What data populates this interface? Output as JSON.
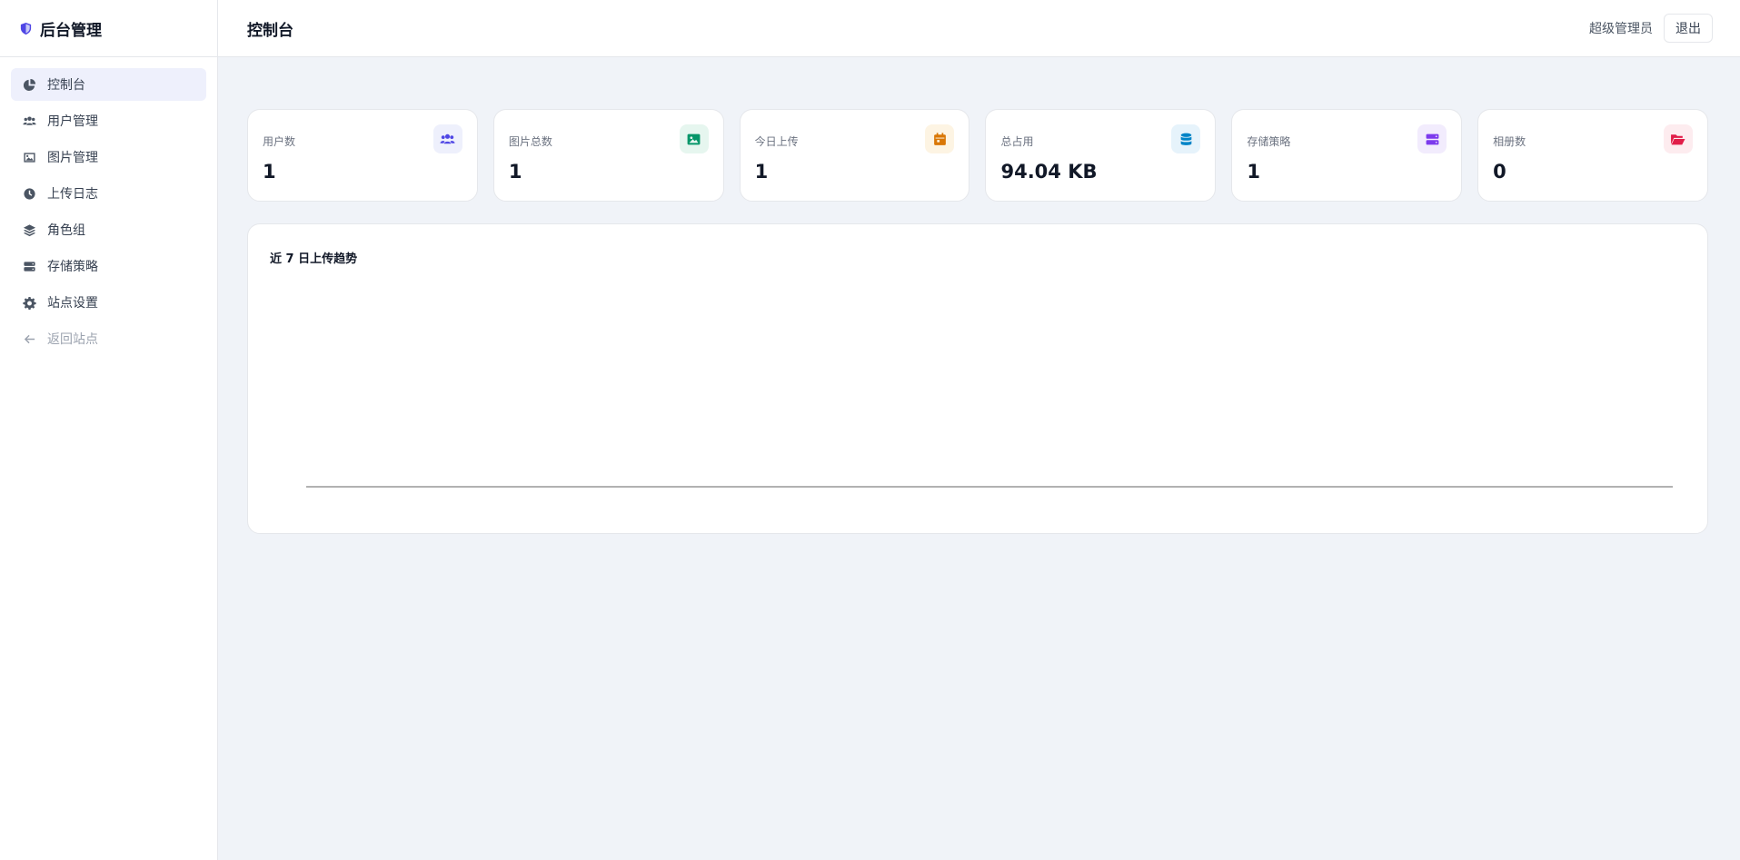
{
  "brand": {
    "title": "后台管理",
    "icon": "shield-icon",
    "icon_color": "#4f46e5"
  },
  "sidebar": {
    "items": [
      {
        "label": "控制台",
        "icon": "pie-chart-icon",
        "active": true
      },
      {
        "label": "用户管理",
        "icon": "users-icon"
      },
      {
        "label": "图片管理",
        "icon": "image-icon"
      },
      {
        "label": "上传日志",
        "icon": "clock-icon"
      },
      {
        "label": "角色组",
        "icon": "layers-icon"
      },
      {
        "label": "存储策略",
        "icon": "server-icon"
      },
      {
        "label": "站点设置",
        "icon": "gear-icon"
      },
      {
        "label": "返回站点",
        "icon": "arrow-left-icon",
        "muted": true
      }
    ]
  },
  "header": {
    "title": "控制台",
    "user": "超级管理员",
    "logout_label": "退出"
  },
  "stats": [
    {
      "label": "用户数",
      "value": "1",
      "icon": "users-icon",
      "color": "#4f46e5",
      "bg": "#eef0fc"
    },
    {
      "label": "图片总数",
      "value": "1",
      "icon": "image-icon",
      "color": "#059669",
      "bg": "#e6f6ef"
    },
    {
      "label": "今日上传",
      "value": "1",
      "icon": "calendar-icon",
      "color": "#d97706",
      "bg": "#fdf4e3"
    },
    {
      "label": "总占用",
      "value": "94.04 KB",
      "icon": "database-icon",
      "color": "#0284c7",
      "bg": "#e6f3fb"
    },
    {
      "label": "存储策略",
      "value": "1",
      "icon": "server-icon",
      "color": "#7c3aed",
      "bg": "#f2ecfd"
    },
    {
      "label": "相册数",
      "value": "0",
      "icon": "folder-open-icon",
      "color": "#e11d48",
      "bg": "#fdecef"
    }
  ],
  "chart": {
    "title": "近 7 日上传趋势"
  },
  "chart_data": {
    "type": "line",
    "title": "近 7 日上传趋势",
    "categories": [],
    "series": [],
    "grid": false
  }
}
